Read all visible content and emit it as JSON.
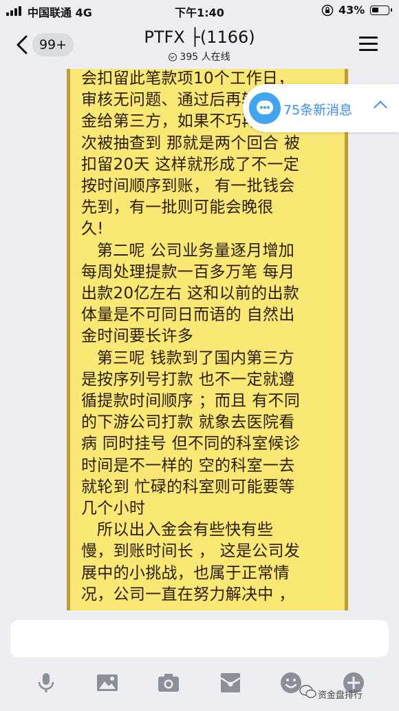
{
  "status_bar": {
    "carrier": "中国联通  4G",
    "time": "下午1:40",
    "battery_percent": "43%",
    "battery_level": 0.43
  },
  "nav": {
    "back_badge": "99+",
    "title": "PTFX ├(1166)",
    "subtitle": "395 人在线"
  },
  "message": {
    "text": "会扣留此笔款项10个工作日，\n审核无问题、通过后再转账\n金给第三方，如果不巧再一\n次被抽查到 那就是两个回合 被\n扣留20天 这样就形成了不一定\n按时间顺序到账， 有一批钱会\n先到，有一批则可能会晚很\n久!\n   第二呢 公司业务量逐月增加\n每周处理提款一百多万笔 每月\n出款20亿左右 这和以前的出款\n体量是不可同日而语的 自然出\n金时间要长许多\n   第三呢 钱款到了国内第三方\n是按序列号打款 也不一定就遵\n循提款时间顺序 ；而且 有不同\n的下游公司打款 就象去医院看\n病 同时挂号 但不同的科室候诊\n时间是不一样的 空的科室一去\n就轮到 忙碌的科室则可能要等\n几个小时\n   所以出入金会有些快有些\n慢，到账时间长 ， 这是公司发\n展中的小挑战，也属于正常情\n况，公司一直在努力解决中 ，"
  },
  "new_messages": {
    "label": "75条新消息"
  },
  "input": {
    "placeholder": ""
  },
  "toolbar": {
    "icons": [
      "microphone-icon",
      "image-icon",
      "camera-icon",
      "red-packet-icon",
      "emoji-icon",
      "plus-icon"
    ]
  },
  "watermark": "资金盘排行",
  "colors": {
    "scroll_bg": "#fae874",
    "scroll_border": "#c39c31",
    "accent_blue": "#3b8ff0",
    "bubble_blue": "#3fa6ee",
    "icon_gray": "#8a8f99"
  }
}
